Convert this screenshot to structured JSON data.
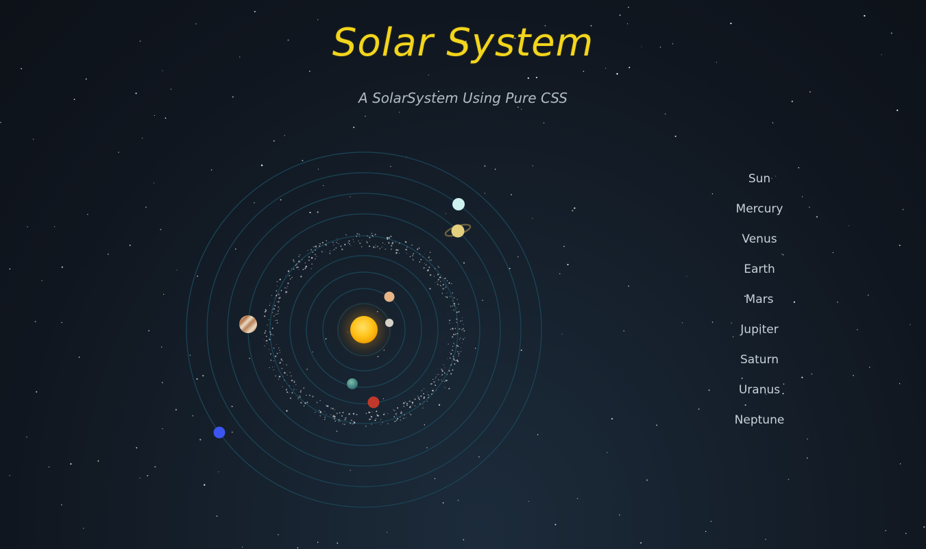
{
  "header": {
    "title": "Solar System",
    "subtitle": "A SolarSystem Using Pure CSS"
  },
  "colors": {
    "title": "#f3d51c",
    "orbit": "#1a4556",
    "sun": "#ffc21a",
    "mercury": "#d6d2c6",
    "venus": "#e8b587",
    "earth": "#3c8a82",
    "mars": "#c0392b",
    "jupiter": "#c9a27a",
    "saturn": "#e3cf7e",
    "uranus": "#cdf2f0",
    "neptune": "#3d55f0"
  },
  "legend": {
    "items": [
      {
        "label": "Sun"
      },
      {
        "label": "Mercury"
      },
      {
        "label": "Venus"
      },
      {
        "label": "Earth"
      },
      {
        "label": "Mars"
      },
      {
        "label": "Jupiter"
      },
      {
        "label": "Saturn"
      },
      {
        "label": "Uranus"
      },
      {
        "label": "Neptune"
      }
    ]
  }
}
